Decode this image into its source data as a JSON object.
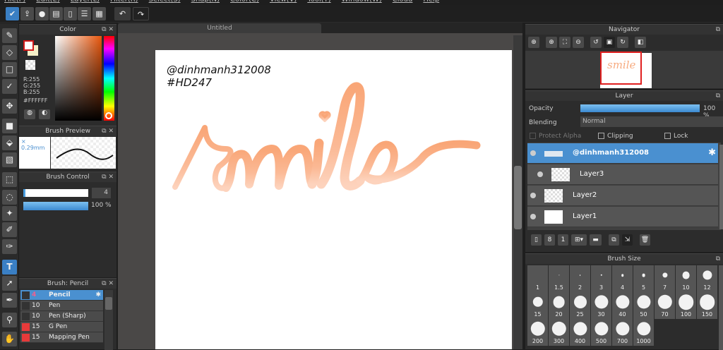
{
  "menu": [
    "File(F)",
    "Edit(E)",
    "Layer(L)",
    "Filter(R)",
    "Select(S)",
    "Snap(N)",
    "Color(C)",
    "View(V)",
    "Tool(T)",
    "Window(W)",
    "Cloud",
    "Help"
  ],
  "document_tab": "Untitled",
  "color_panel": {
    "title": "Color",
    "r": "R:255",
    "g": "G:255",
    "b": "B:255",
    "hex": "#FFFFFF",
    "fg": "#ffffff",
    "bg": "#f4efc8"
  },
  "brush_preview": {
    "title": "Brush Preview",
    "size": "0.29mm"
  },
  "brush_control": {
    "title": "Brush Control",
    "size": "4",
    "opacity": "100 %",
    "size_fraction": 0.03,
    "opacity_fraction": 1.0
  },
  "brush_list": {
    "title": "Brush: Pencil",
    "items": [
      {
        "size": "4",
        "name": "Pencil",
        "color": "#333333",
        "selected": true
      },
      {
        "size": "10",
        "name": "Pen",
        "color": "#333333"
      },
      {
        "size": "10",
        "name": "Pen (Sharp)",
        "color": "#333333"
      },
      {
        "size": "15",
        "name": "G Pen",
        "color": "#e83a3a"
      },
      {
        "size": "15",
        "name": "Mapping Pen",
        "color": "#e83a3a"
      }
    ]
  },
  "canvas": {
    "line1": "@dinhmanh312008",
    "line2": "#HD247",
    "art_text": "smile"
  },
  "navigator": {
    "title": "Navigator",
    "preview_text": "smile"
  },
  "layer_panel": {
    "title": "Layer",
    "opacity_label": "Opacity",
    "opacity_value": "100 %",
    "opacity_fraction": 1.0,
    "blending_label": "Blending",
    "blending_value": "Normal",
    "protect_alpha": "Protect Alpha",
    "clipping": "Clipping",
    "lock": "Lock",
    "layers": [
      {
        "name": "@dinhmanh312008",
        "selected": true
      },
      {
        "name": "Layer3"
      },
      {
        "name": "Layer2"
      },
      {
        "name": "Layer1"
      }
    ]
  },
  "brush_size": {
    "title": "Brush Size",
    "sizes": [
      "1",
      "1.5",
      "2",
      "3",
      "4",
      "5",
      "7",
      "10",
      "12",
      "15",
      "20",
      "25",
      "30",
      "40",
      "50",
      "70",
      "100",
      "150",
      "200",
      "300",
      "400",
      "500",
      "700",
      "1000"
    ]
  }
}
